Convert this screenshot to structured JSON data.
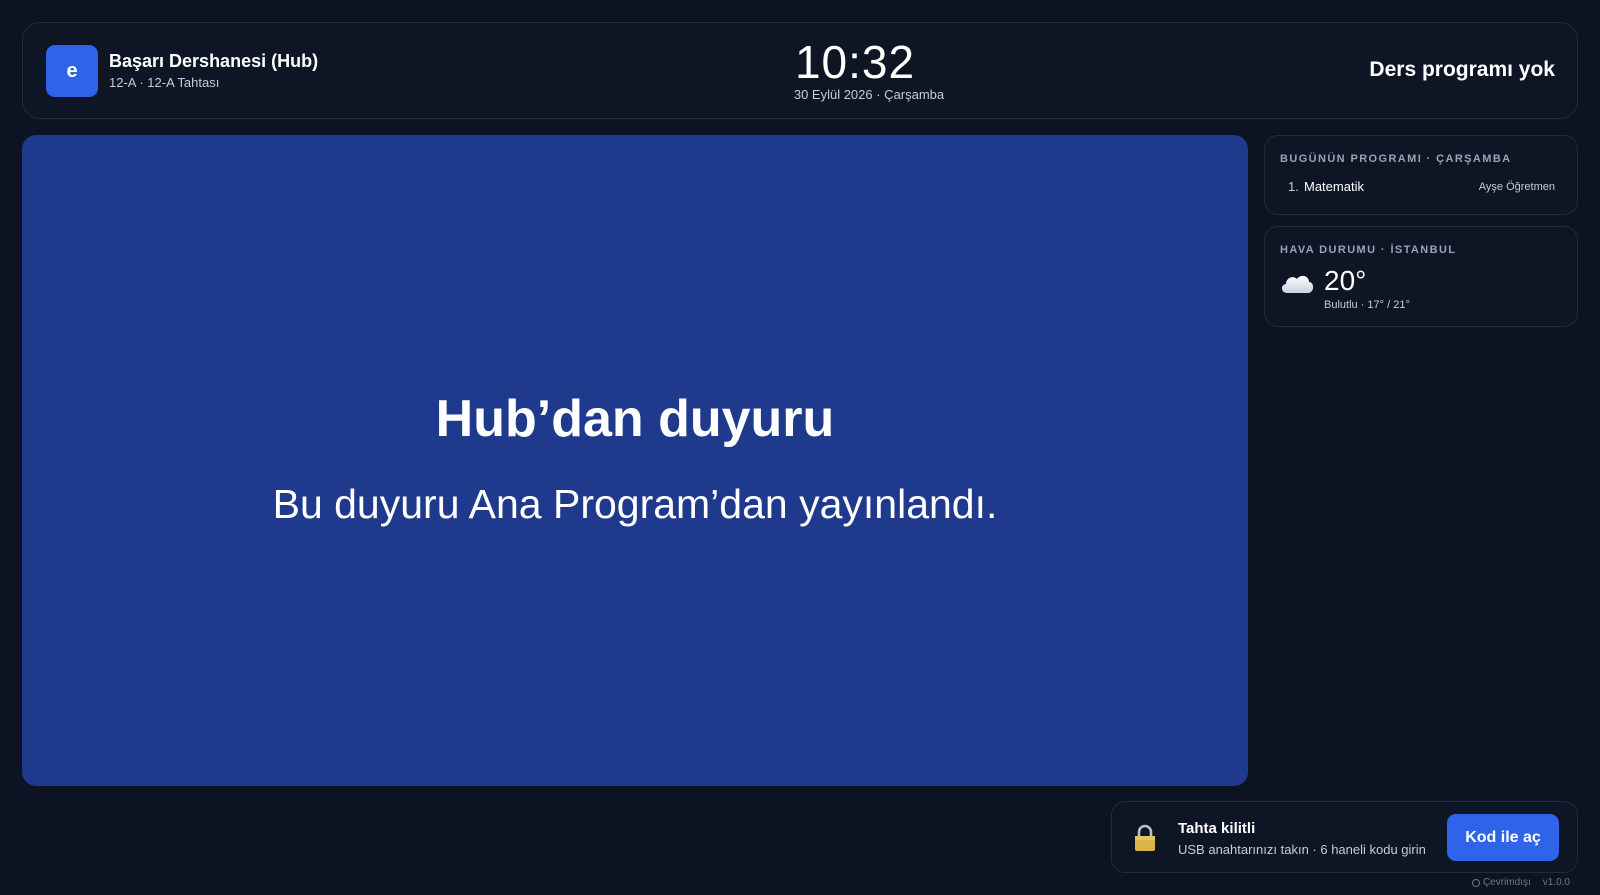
{
  "header": {
    "logo_letter": "e",
    "org_name": "Başarı Dershanesi (Hub)",
    "org_sub": "12-A · 12-A Tahtası",
    "time": "10:32",
    "date": "30 Eylül 2026 · Çarşamba",
    "status": "Ders programı yok"
  },
  "announcement": {
    "title": "Hub’dan duyuru",
    "body": "Bu duyuru Ana Program’dan yayınlandı.",
    "background": "#1f3a8c"
  },
  "schedule": {
    "label": "BUGÜNÜN PROGRAMI · ÇARŞAMBA",
    "items": [
      {
        "number": "1.",
        "subject": "Matematik",
        "teacher": "Ayşe Öğretmen"
      }
    ]
  },
  "weather": {
    "label": "HAVA DURUMU · İSTANBUL",
    "icon": "cloud-icon",
    "temperature": "20°",
    "description": "Bulutlu · 17° / 21°"
  },
  "lock": {
    "icon": "lock-icon",
    "title": "Tahta kilitli",
    "description": "USB anahtarınızı takın · 6 haneli kodu girin",
    "button_label": "Kod ile aç"
  },
  "footer": {
    "connection": "Çevrimdışı",
    "version": "v1.0.0"
  },
  "colors": {
    "background": "#0d1322",
    "accent": "#2f63ea",
    "card_border": "#232b3c"
  }
}
